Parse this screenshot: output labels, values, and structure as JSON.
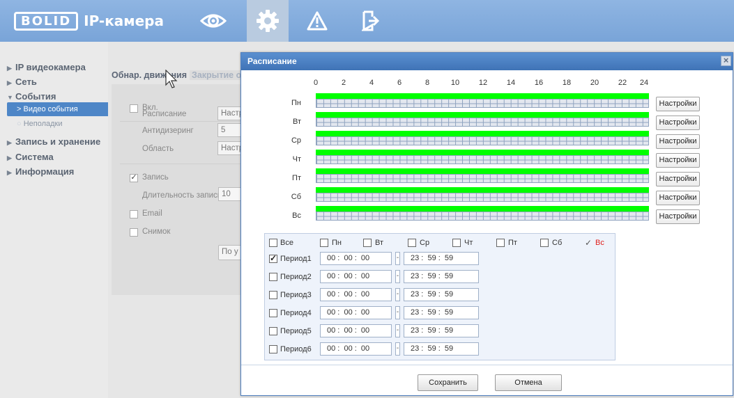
{
  "header": {
    "logo": "BOLID",
    "product": "IP-камера",
    "nav": [
      {
        "icon": "eye-icon",
        "active": false
      },
      {
        "icon": "gear-icon",
        "active": true
      },
      {
        "icon": "alarm-icon",
        "active": false
      },
      {
        "icon": "exit-icon",
        "active": false
      }
    ]
  },
  "sidebar": {
    "items": [
      {
        "label": "IP видеокамера",
        "arrow": "▶"
      },
      {
        "label": "Сеть",
        "arrow": "▶"
      },
      {
        "label": "События",
        "arrow": "▼"
      },
      {
        "label": "Запись и хранение",
        "arrow": "▶"
      },
      {
        "label": "Система",
        "arrow": "▶"
      },
      {
        "label": "Информация",
        "arrow": "▶"
      }
    ],
    "subitems": [
      {
        "label": "> Видео события",
        "active": true
      },
      {
        "label": "Неполадки",
        "active": false
      }
    ]
  },
  "main": {
    "tab_active": "Обнар. движения",
    "tab_inactive": "Закрытие об",
    "enable_label": "Вкл.",
    "schedule_label": "Расписание",
    "schedule_btn": "Настр",
    "antidither_label": "Антидизеринг",
    "antidither_value": "5",
    "area_label": "Область",
    "area_btn": "Настр",
    "record_label": "Запись",
    "record_duration_label": "Длительность записи",
    "record_duration_value": "10",
    "email_label": "Email",
    "snapshot_label": "Снимок",
    "default_btn": "По у"
  },
  "dialog": {
    "title": "Расписание",
    "close": "×",
    "hours": [
      "0",
      "2",
      "4",
      "6",
      "8",
      "10",
      "12",
      "14",
      "16",
      "18",
      "20",
      "22",
      "24"
    ],
    "days": [
      "Пн",
      "Вт",
      "Ср",
      "Чт",
      "Пт",
      "Сб",
      "Вс"
    ],
    "settings_label": "Настройки",
    "day_checks": [
      {
        "label": "Все",
        "checked": false,
        "highlight": false
      },
      {
        "label": "Пн",
        "checked": false,
        "highlight": false
      },
      {
        "label": "Вт",
        "checked": false,
        "highlight": false
      },
      {
        "label": "Ср",
        "checked": false,
        "highlight": false
      },
      {
        "label": "Чт",
        "checked": false,
        "highlight": false
      },
      {
        "label": "Пт",
        "checked": false,
        "highlight": false
      },
      {
        "label": "Сб",
        "checked": false,
        "highlight": false
      },
      {
        "label": "Вс",
        "checked": true,
        "highlight": true
      }
    ],
    "periods": [
      {
        "label": "Период1",
        "checked": true,
        "start": "00 :  00 :  00",
        "end": "23 :  59 :  59"
      },
      {
        "label": "Период2",
        "checked": false,
        "start": "00 :  00 :  00",
        "end": "23 :  59 :  59"
      },
      {
        "label": "Период3",
        "checked": false,
        "start": "00 :  00 :  00",
        "end": "23 :  59 :  59"
      },
      {
        "label": "Период4",
        "checked": false,
        "start": "00 :  00 :  00",
        "end": "23 :  59 :  59"
      },
      {
        "label": "Период5",
        "checked": false,
        "start": "00 :  00 :  00",
        "end": "23 :  59 :  59"
      },
      {
        "label": "Период6",
        "checked": false,
        "start": "00 :  00 :  00",
        "end": "23 :  59 :  59"
      }
    ],
    "save": "Сохранить",
    "cancel": "Отмена"
  },
  "colors": {
    "header": "#7fa9dc",
    "accent": "#4e86c7",
    "schedule_on": "#00ff00",
    "highlight_day": "#e0201e"
  }
}
